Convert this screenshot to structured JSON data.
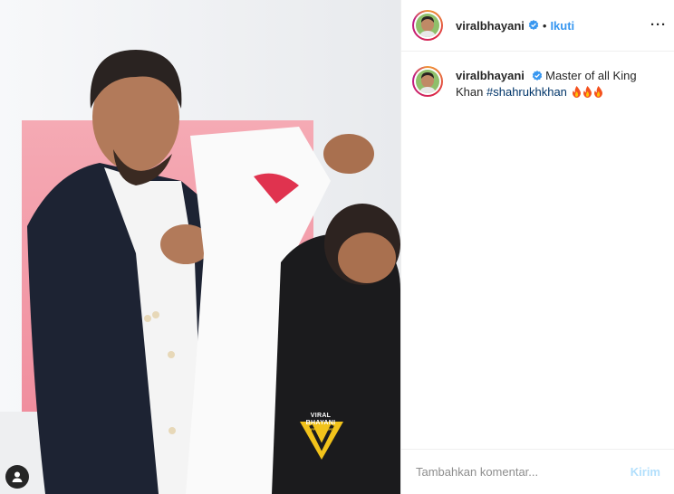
{
  "post": {
    "username": "viralbhayani",
    "separator": "•",
    "follow_label": "Ikuti",
    "more_label": "···",
    "caption_text": "Master of all King Khan",
    "hashtag": "#shahrukhkhan",
    "emoji_count": 3
  },
  "media": {
    "watermark_title": "VIRAL BHAYANI",
    "watermark_sub": "OFFICIAL APP"
  },
  "comment_box": {
    "placeholder": "Tambahkan komentar...",
    "send_label": "Kirim"
  },
  "colors": {
    "follow_blue": "#3897f0",
    "hashtag_blue": "#003569",
    "send_disabled": "#b2dffc",
    "verified_blue": "#3897f0",
    "pink_backdrop": "#f0a7b2"
  },
  "icons": [
    "verified-badge-icon",
    "more-options-icon",
    "user-tag-icon",
    "fire-emoji-icon"
  ]
}
